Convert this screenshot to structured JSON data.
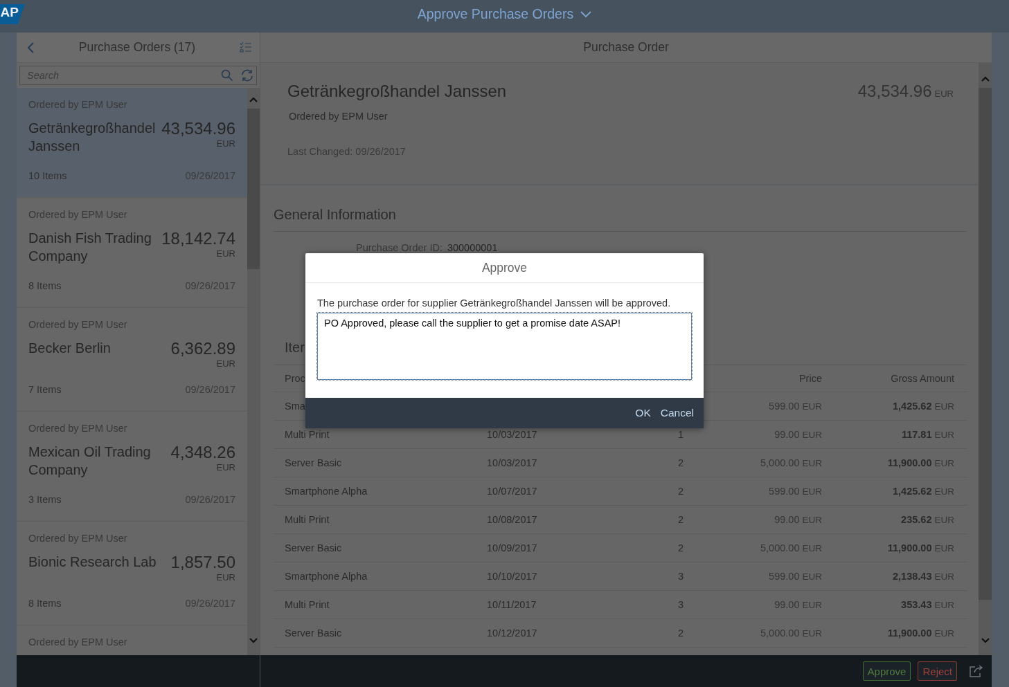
{
  "shell": {
    "logo_text": "AP",
    "title": "Approve Purchase Orders"
  },
  "master": {
    "title": "Purchase Orders (17)",
    "search": {
      "placeholder": "Search"
    },
    "items": [
      {
        "ordered_by": "Ordered by EPM User",
        "name": "Getränkegroßhandel Janssen",
        "amount": "43,534.96",
        "currency": "EUR",
        "items": "10 Items",
        "date": "09/26/2017",
        "selected": true
      },
      {
        "ordered_by": "Ordered by EPM User",
        "name": "Danish Fish Trading Company",
        "amount": "18,142.74",
        "currency": "EUR",
        "items": "8 Items",
        "date": "09/26/2017",
        "selected": false
      },
      {
        "ordered_by": "Ordered by EPM User",
        "name": "Becker Berlin",
        "amount": "6,362.89",
        "currency": "EUR",
        "items": "7 Items",
        "date": "09/26/2017",
        "selected": false
      },
      {
        "ordered_by": "Ordered by EPM User",
        "name": "Mexican Oil Trading Company",
        "amount": "4,348.26",
        "currency": "EUR",
        "items": "3 Items",
        "date": "09/26/2017",
        "selected": false
      },
      {
        "ordered_by": "Ordered by EPM User",
        "name": "Bionic Research Lab",
        "amount": "1,857.50",
        "currency": "EUR",
        "items": "8 Items",
        "date": "09/26/2017",
        "selected": false
      },
      {
        "ordered_by": "Ordered by EPM User",
        "selected": false
      }
    ]
  },
  "detail": {
    "title": "Purchase Order",
    "header": {
      "name": "Getränkegroßhandel Janssen",
      "ordered_by": "Ordered by EPM User",
      "amount": "43,534.96",
      "currency": "EUR",
      "last_changed": "Last Changed: 09/26/2017"
    },
    "general_information": {
      "title": "General Information",
      "fields": [
        {
          "label": "Purchase Order ID:",
          "value": "300000001"
        }
      ]
    },
    "items_section": {
      "title": "Iter",
      "columns": [
        {
          "kind": "product",
          "label": "Proc"
        },
        {
          "kind": "price",
          "label": "Price"
        },
        {
          "kind": "gross_amount",
          "label": "Gross Amount"
        }
      ],
      "rows": [
        {
          "product": "Sma",
          "price": "599.00",
          "price_currency": "EUR",
          "gross_amount": "1,425.62",
          "gross_currency": "EUR"
        },
        {
          "product": "Multi Print",
          "column_2": "10/03/2017",
          "column_3": "1",
          "price": "99.00",
          "price_currency": "EUR",
          "gross_amount": "117.81",
          "gross_currency": "EUR"
        },
        {
          "product": "Server Basic",
          "column_2": "10/03/2017",
          "column_3": "2",
          "price": "5,000.00",
          "price_currency": "EUR",
          "gross_amount": "11,900.00",
          "gross_currency": "EUR"
        },
        {
          "product": "Smartphone Alpha",
          "column_2": "10/07/2017",
          "column_3": "2",
          "price": "599.00",
          "price_currency": "EUR",
          "gross_amount": "1,425.62",
          "gross_currency": "EUR"
        },
        {
          "product": "Multi Print",
          "column_2": "10/08/2017",
          "column_3": "2",
          "price": "99.00",
          "price_currency": "EUR",
          "gross_amount": "235.62",
          "gross_currency": "EUR"
        },
        {
          "product": "Server Basic",
          "column_2": "10/09/2017",
          "column_3": "2",
          "price": "5,000.00",
          "price_currency": "EUR",
          "gross_amount": "11,900.00",
          "gross_currency": "EUR"
        },
        {
          "product": "Smartphone Alpha",
          "column_2": "10/10/2017",
          "column_3": "3",
          "price": "599.00",
          "price_currency": "EUR",
          "gross_amount": "2,138.43",
          "gross_currency": "EUR"
        },
        {
          "product": "Multi Print",
          "column_2": "10/11/2017",
          "column_3": "3",
          "price": "99.00",
          "price_currency": "EUR",
          "gross_amount": "353.43",
          "gross_currency": "EUR"
        },
        {
          "product": "Server Basic",
          "column_2": "10/12/2017",
          "column_3": "2",
          "price": "5,000.00",
          "price_currency": "EUR",
          "gross_amount": "11,900.00",
          "gross_currency": "EUR"
        }
      ]
    }
  },
  "footer": {
    "actions": [
      {
        "kind": "accept",
        "label": "Approve"
      },
      {
        "kind": "reject",
        "label": "Reject"
      }
    ]
  },
  "dialog": {
    "title": "Approve",
    "message": "The purchase order for supplier Getränkegroßhandel Janssen will be approved.",
    "note": "PO Approved, please call the supplier to get a promise date ASAP!",
    "buttons": [
      "OK",
      "Cancel"
    ]
  }
}
